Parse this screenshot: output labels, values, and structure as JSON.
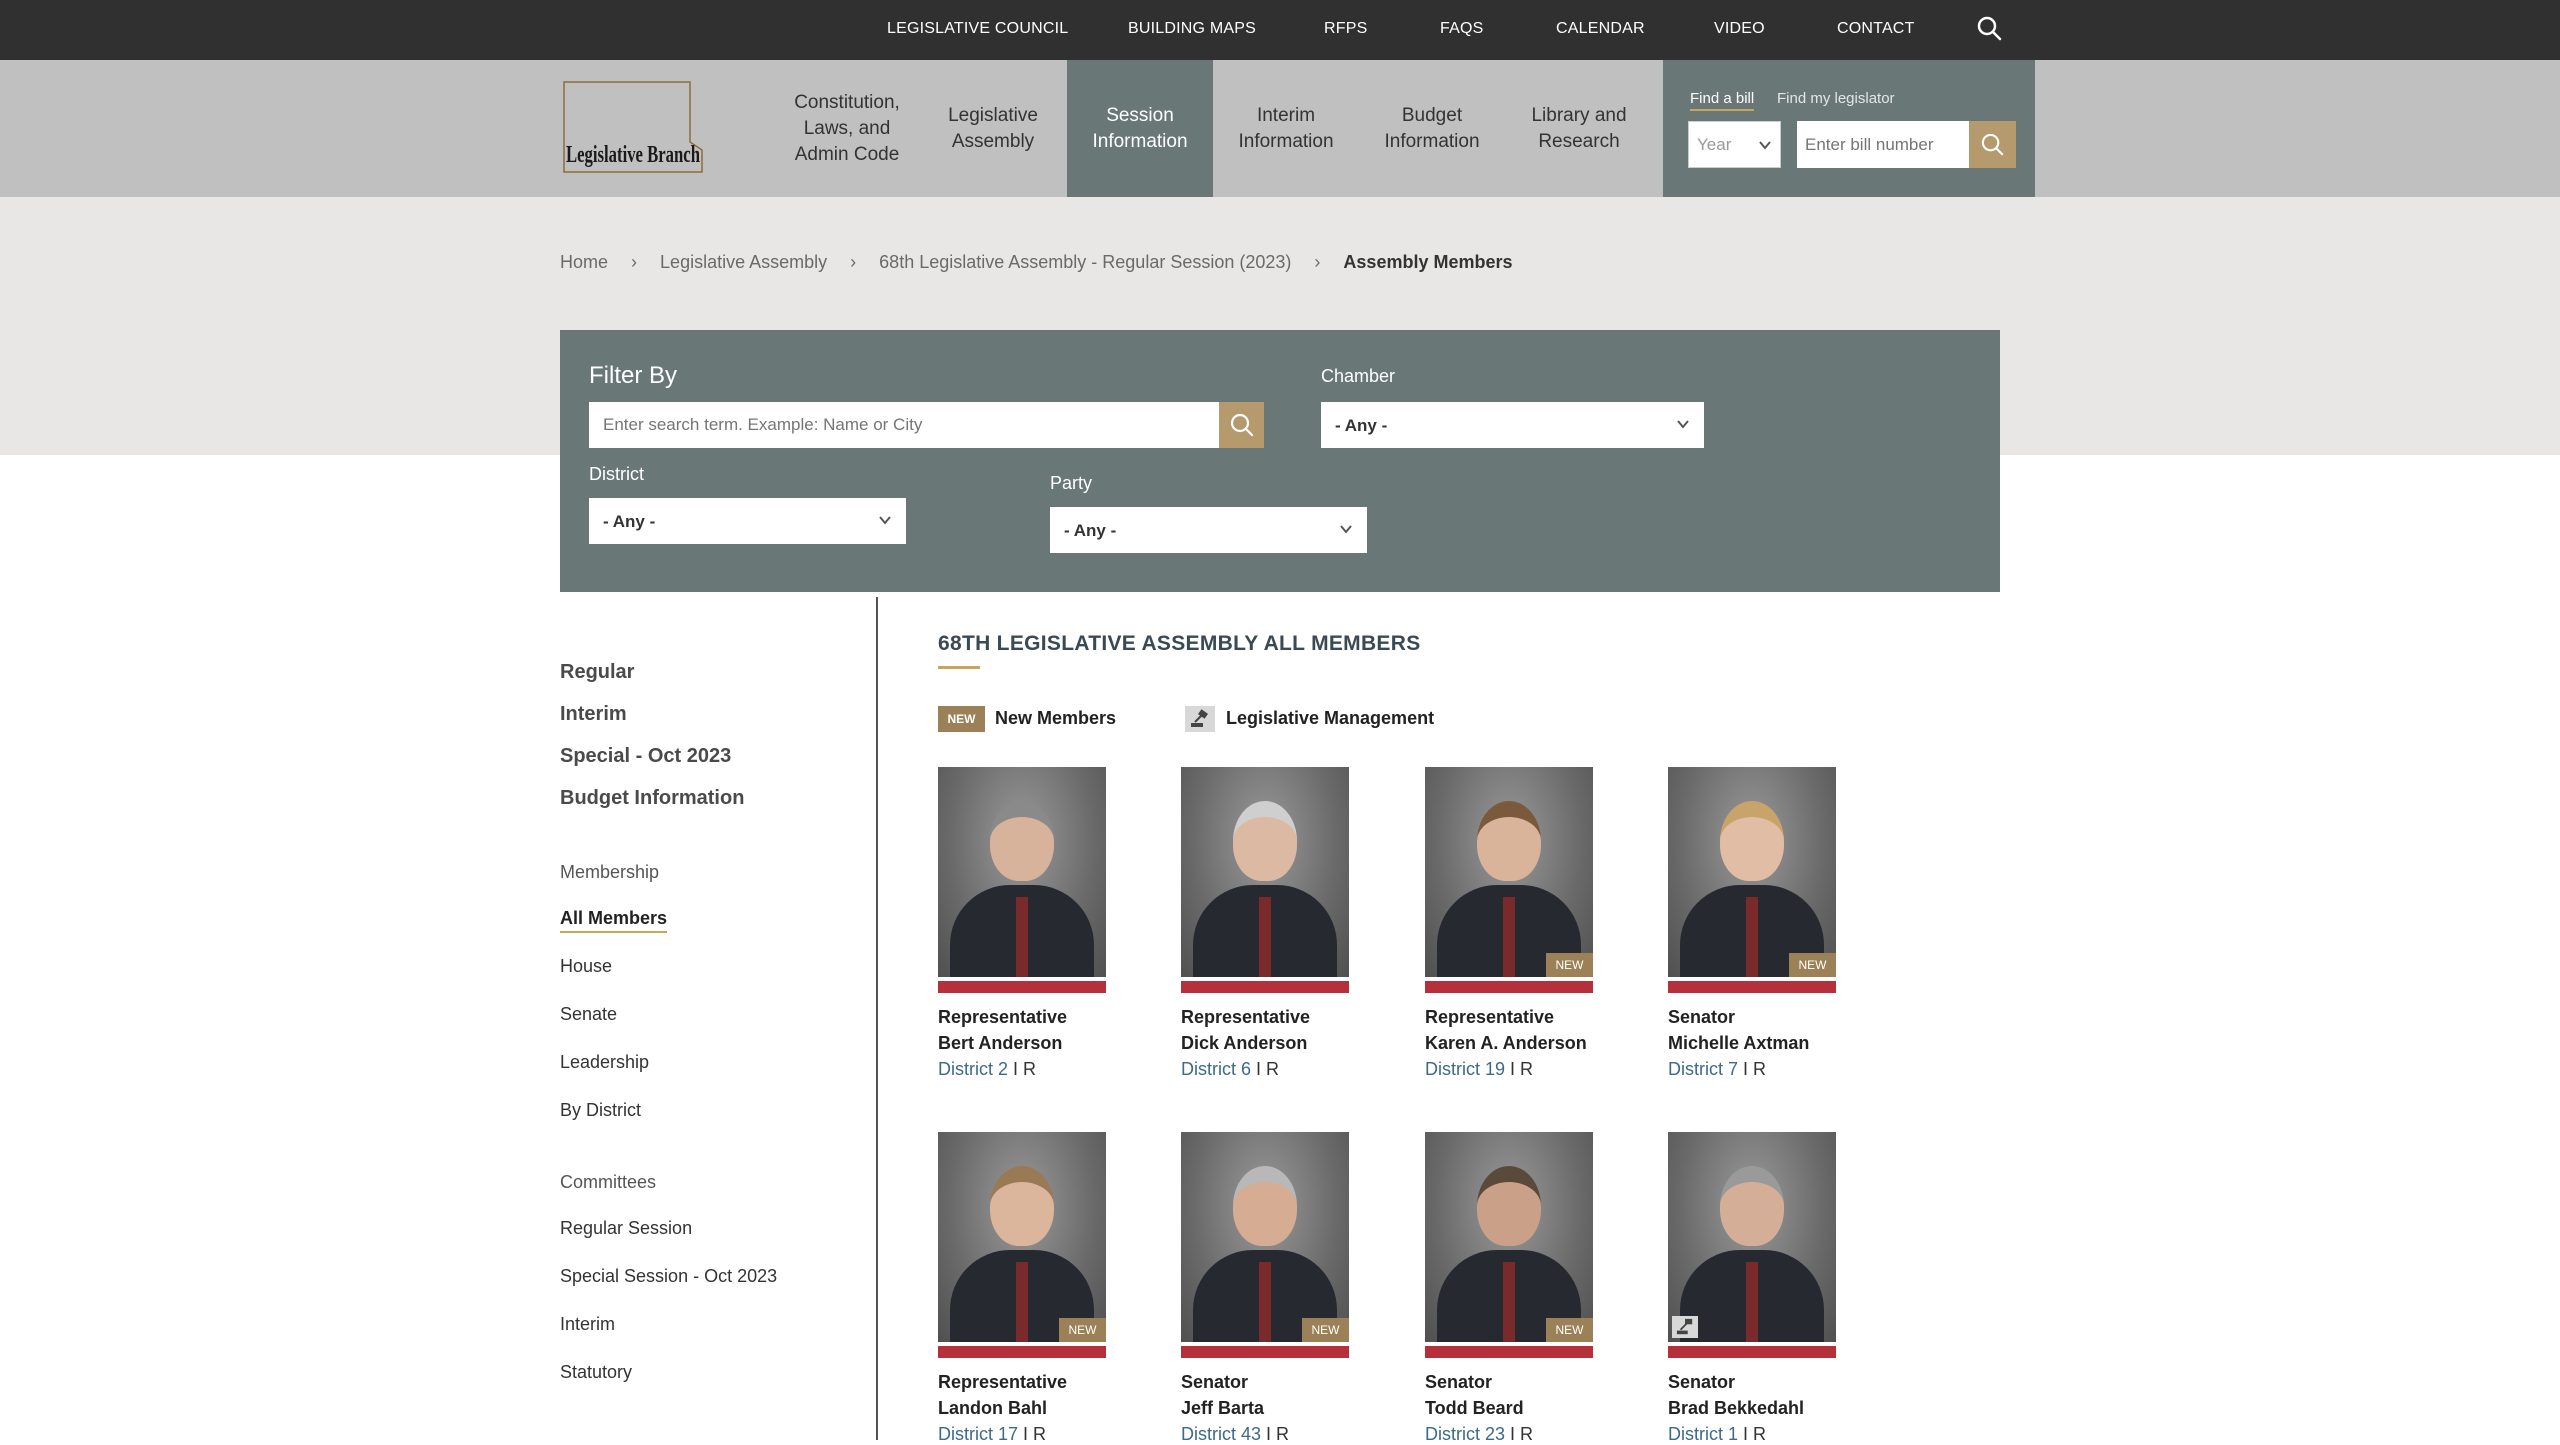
{
  "top_nav": {
    "items": [
      "LEGISLATIVE COUNCIL",
      "BUILDING MAPS",
      "RFPS",
      "FAQS",
      "CALENDAR",
      "VIDEO",
      "CONTACT"
    ],
    "search_icon": "search-icon"
  },
  "logo": {
    "text": "Legislative Branch"
  },
  "main_nav": {
    "items": [
      {
        "label": "Constitution,\nLaws, and\nAdmin Code",
        "active": false
      },
      {
        "label": "Legislative\nAssembly",
        "active": false
      },
      {
        "label": "Session\nInformation",
        "active": true
      },
      {
        "label": "Interim\nInformation",
        "active": false
      },
      {
        "label": "Budget\nInformation",
        "active": false
      },
      {
        "label": "Library and\nResearch",
        "active": false
      }
    ]
  },
  "find": {
    "tab_bill": "Find a bill",
    "tab_legislator": "Find my legislator",
    "year_placeholder": "Year",
    "bill_placeholder": "Enter bill number"
  },
  "breadcrumb": {
    "items": [
      "Home",
      "Legislative Assembly",
      "68th Legislative Assembly - Regular Session (2023)"
    ],
    "separator": "›",
    "current": "Assembly Members"
  },
  "filter": {
    "title": "Filter By",
    "search_placeholder": "Enter search term. Example: Name or City",
    "chamber_label": "Chamber",
    "chamber_value": "- Any -",
    "district_label": "District",
    "district_value": "- Any -",
    "party_label": "Party",
    "party_value": "- Any -"
  },
  "sidebar": {
    "sessions": [
      "Regular",
      "Interim",
      "Special - Oct 2023",
      "Budget Information"
    ],
    "membership_heading": "Membership",
    "membership_items": [
      "All Members",
      "House",
      "Senate",
      "Leadership",
      "By District"
    ],
    "committees_heading": "Committees",
    "committees_items": [
      "Regular Session",
      "Special Session - Oct 2023",
      "Interim",
      "Statutory"
    ]
  },
  "main": {
    "title": "68TH LEGISLATIVE ASSEMBLY ALL MEMBERS",
    "legend_new_badge": "NEW",
    "legend_new_label": "New Members",
    "legend_mgmt_label": "Legislative Management"
  },
  "members": [
    {
      "role": "Representative",
      "name": "Bert Anderson",
      "district": "District 2",
      "party": "R",
      "badge": "",
      "gavel": false
    },
    {
      "role": "Representative",
      "name": "Dick Anderson",
      "district": "District 6",
      "party": "R",
      "badge": "",
      "gavel": false
    },
    {
      "role": "Representative",
      "name": "Karen A. Anderson",
      "district": "District 19",
      "party": "R",
      "badge": "NEW",
      "gavel": false
    },
    {
      "role": "Senator",
      "name": "Michelle Axtman",
      "district": "District 7",
      "party": "R",
      "badge": "NEW",
      "gavel": false
    },
    {
      "role": "Representative",
      "name": "Landon Bahl",
      "district": "District 17",
      "party": "R",
      "badge": "NEW",
      "gavel": false
    },
    {
      "role": "Senator",
      "name": "Jeff Barta",
      "district": "District 43",
      "party": "R",
      "badge": "NEW",
      "gavel": false
    },
    {
      "role": "Senator",
      "name": "Todd Beard",
      "district": "District 23",
      "party": "R",
      "badge": "NEW",
      "gavel": false
    },
    {
      "role": "Senator",
      "name": "Brad Bekkedahl",
      "district": "District 1",
      "party": "R",
      "badge": "",
      "gavel": true
    }
  ],
  "colors": {
    "topbar": "#303030",
    "navbar": "#bfc0bf",
    "slate": "#6a7777",
    "gold": "#b59a6e",
    "red": "#b5303a",
    "link": "#3d6a8a"
  }
}
